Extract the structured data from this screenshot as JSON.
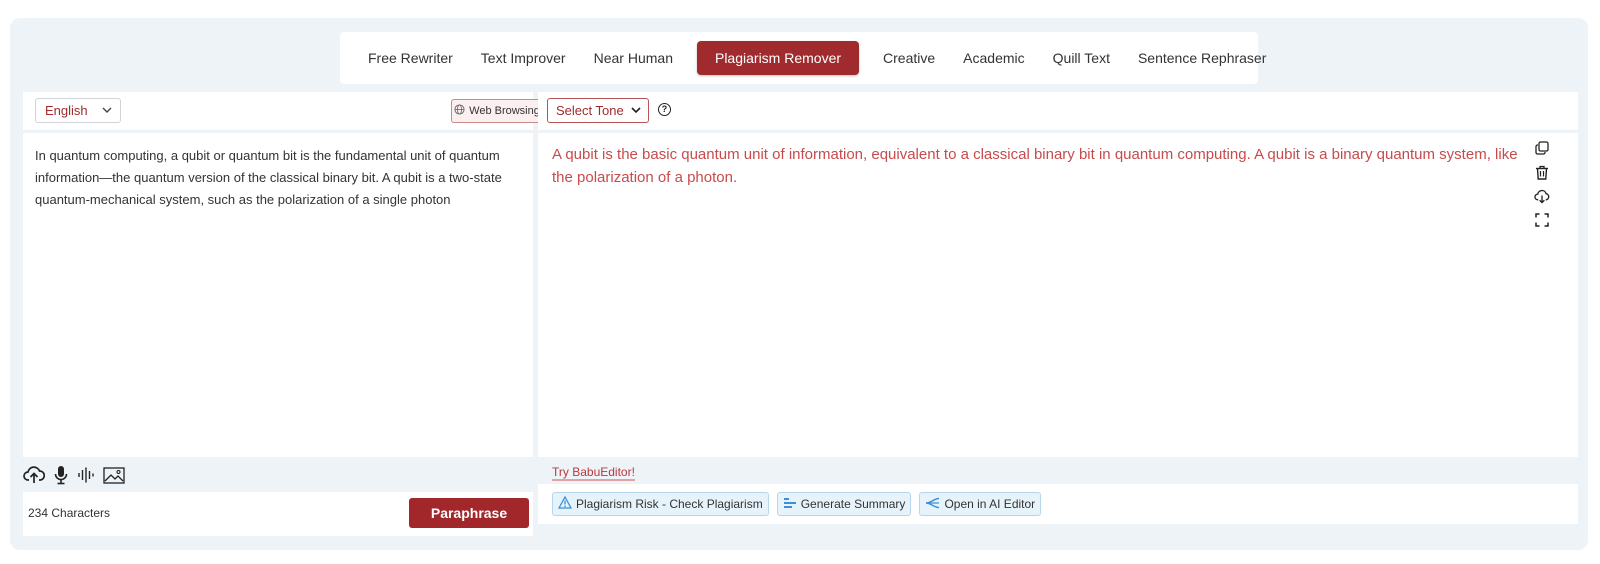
{
  "tabs": [
    {
      "label": "Free Rewriter",
      "active": false
    },
    {
      "label": "Text Improver",
      "active": false
    },
    {
      "label": "Near Human",
      "active": false
    },
    {
      "label": "Plagiarism Remover",
      "active": true
    },
    {
      "label": "Creative",
      "active": false
    },
    {
      "label": "Academic",
      "active": false
    },
    {
      "label": "Quill Text",
      "active": false
    },
    {
      "label": "Sentence Rephraser",
      "active": false
    }
  ],
  "left": {
    "language": "English",
    "web_browsing_label": "Web Browsing",
    "input_text": "In quantum computing, a qubit or quantum bit is the fundamental unit of quantum information—the quantum version of the classical binary bit. A qubit is a two-state quantum-mechanical system, such as the polarization of a single photon",
    "char_count": "234 Characters",
    "paraphrase_label": "Paraphrase",
    "input_icons": [
      "upload-cloud-icon",
      "microphone-icon",
      "audio-wave-icon",
      "image-icon"
    ]
  },
  "right": {
    "tone_select": "Select Tone",
    "output_text": "A qubit is the basic quantum unit of information, equivalent to a classical binary bit in quantum computing. A qubit is a binary quantum system, like the polarization of a photon.",
    "side_tools": [
      "copy-icon",
      "trash-icon",
      "cloud-download-icon",
      "fullscreen-icon"
    ],
    "try_link": "Try BabuEditor!",
    "actions": [
      {
        "label": "Plagiarism Risk - Check Plagiarism",
        "icon": "warning-icon"
      },
      {
        "label": "Generate Summary",
        "icon": "summary-icon"
      },
      {
        "label": "Open in AI Editor",
        "icon": "ai-editor-icon"
      }
    ]
  },
  "colors": {
    "accent": "#9f2b2e",
    "output_text": "#c74b4c",
    "panel_bg": "#eef3f7",
    "chip_bg": "#e7f3fb"
  }
}
